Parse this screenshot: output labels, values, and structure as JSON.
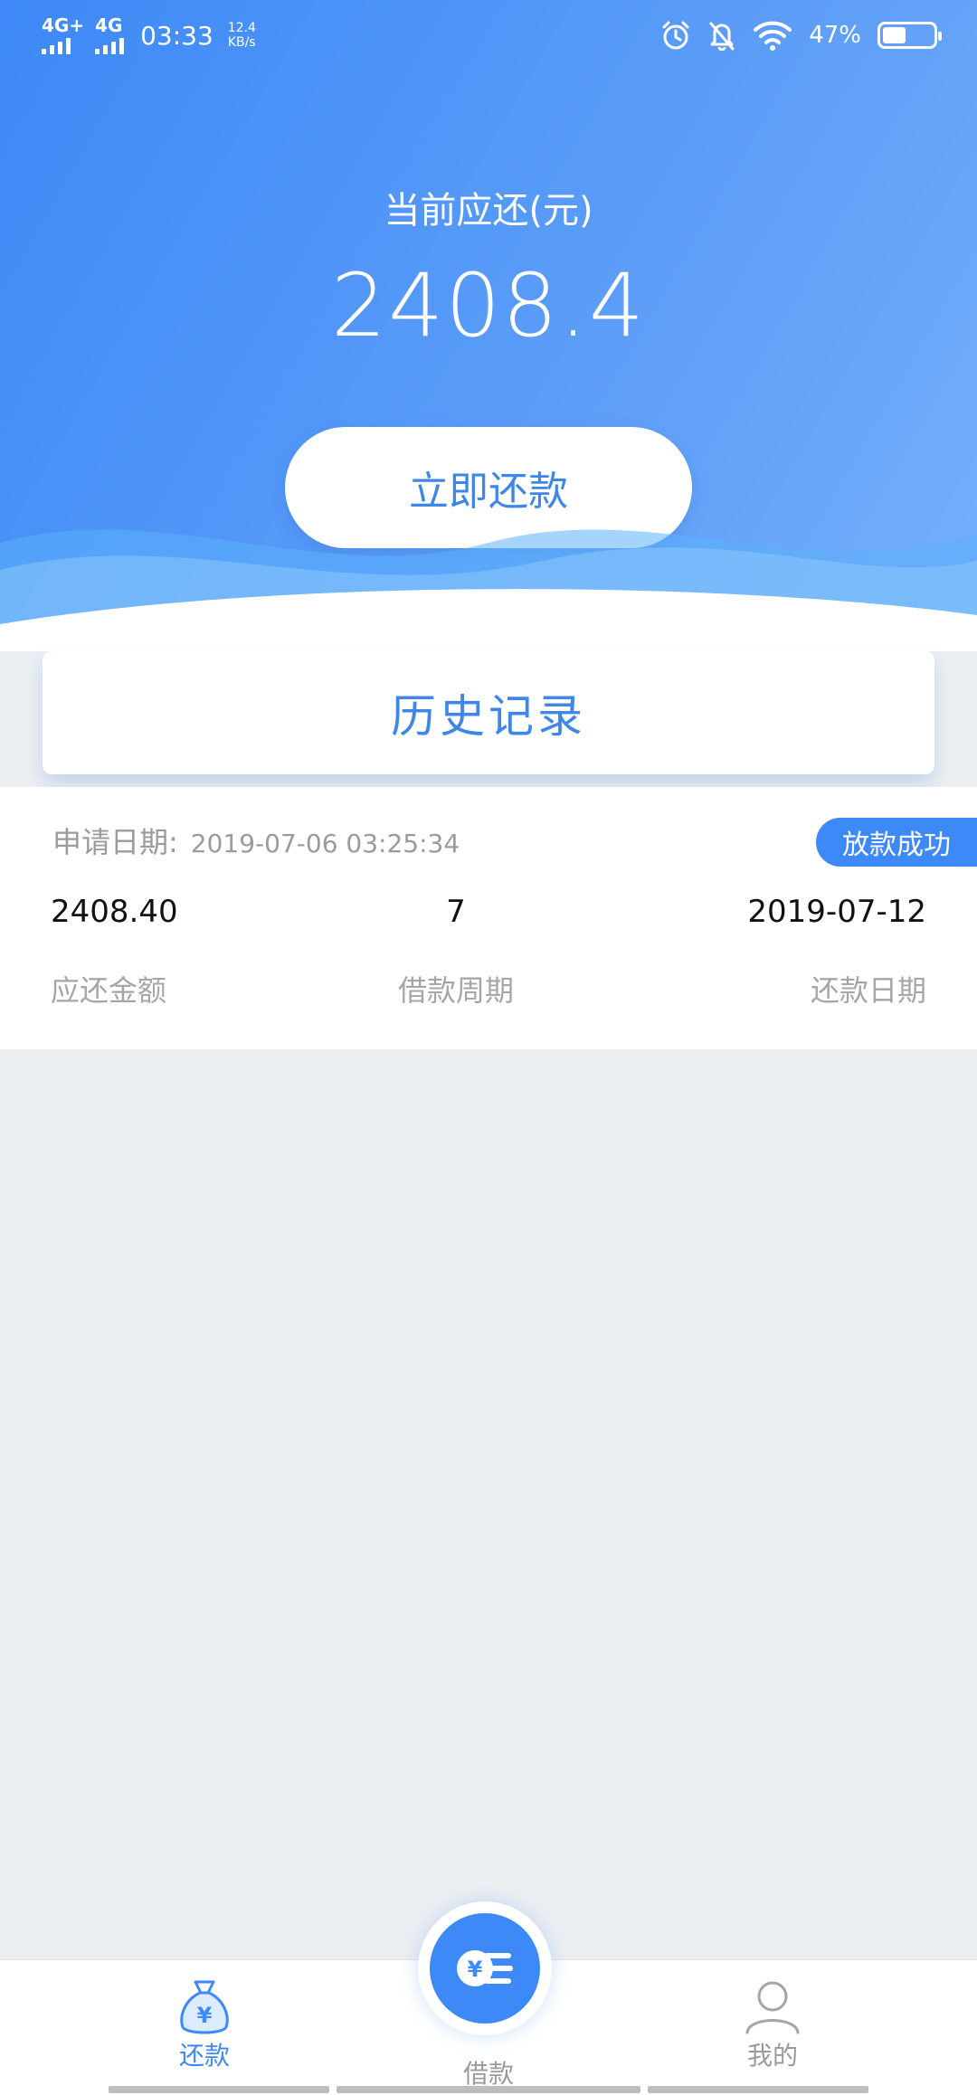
{
  "status_bar": {
    "network1": "4G+",
    "network2": "4G",
    "time": "03:33",
    "speed_value": "12.4",
    "speed_unit": "KB/s",
    "battery": "47%",
    "battery_level": 0.47
  },
  "header": {
    "due_label": "当前应还(元)",
    "due_amount": "2408.4",
    "repay_button": "立即还款"
  },
  "history": {
    "title": "历史记录"
  },
  "record": {
    "apply_label": "申请日期:",
    "apply_date": "2019-07-06 03:25:34",
    "status": "放款成功",
    "columns": [
      {
        "value": "2408.40",
        "label": "应还金额"
      },
      {
        "value": "7",
        "label": "借款周期"
      },
      {
        "value": "2019-07-12",
        "label": "还款日期"
      }
    ]
  },
  "nav": {
    "repay": "还款",
    "borrow": "借款",
    "me": "我的",
    "repay_icon": "money-bag-icon",
    "borrow_icon": "yen-coin-icon",
    "me_icon": "user-icon"
  },
  "colors": {
    "primary": "#3D89F7",
    "background": "#ECEFF2"
  }
}
